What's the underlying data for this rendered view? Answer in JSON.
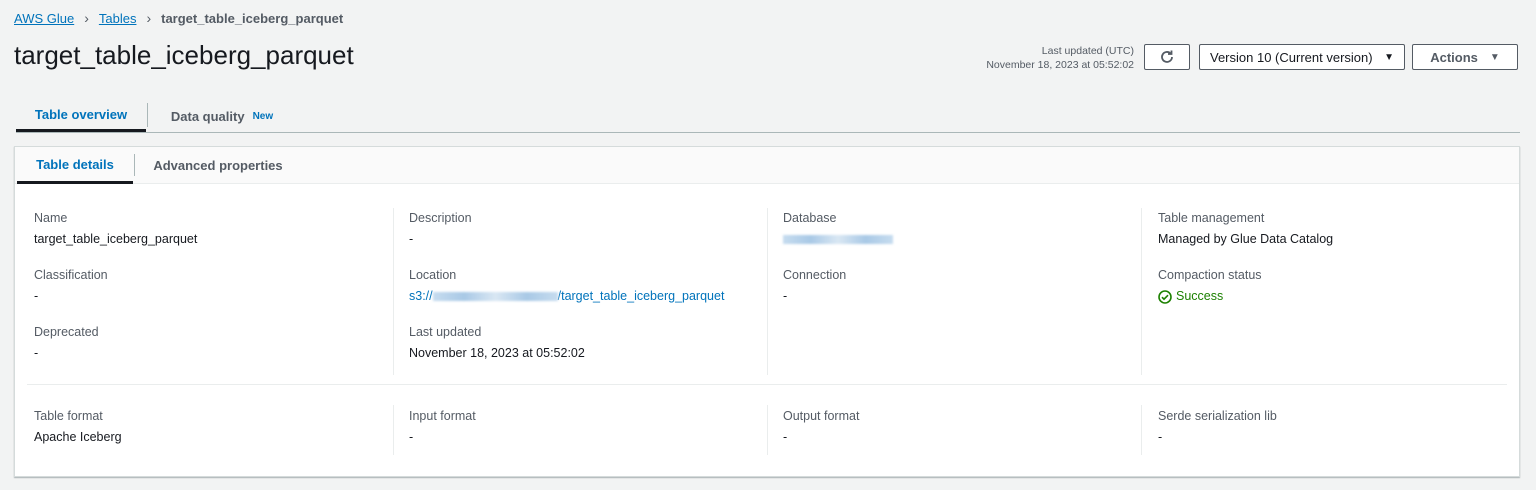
{
  "breadcrumb": [
    "AWS Glue",
    "Tables",
    "target_table_iceberg_parquet"
  ],
  "page_title": "target_table_iceberg_parquet",
  "last_updated": {
    "label": "Last updated (UTC)",
    "value": "November 18, 2023 at 05:52:02"
  },
  "version_select": "Version 10 (Current version)",
  "actions_label": "Actions",
  "tabs": [
    {
      "label": "Table overview"
    },
    {
      "label": "Data quality",
      "badge": "New"
    }
  ],
  "subtabs": [
    "Table details",
    "Advanced properties"
  ],
  "fields": {
    "name": {
      "label": "Name",
      "value": "target_table_iceberg_parquet"
    },
    "description": {
      "label": "Description",
      "value": "-"
    },
    "database": {
      "label": "Database"
    },
    "table_management": {
      "label": "Table management",
      "value": "Managed by Glue Data Catalog"
    },
    "classification": {
      "label": "Classification",
      "value": "-"
    },
    "location": {
      "label": "Location",
      "prefix": "s3://",
      "suffix": "/target_table_iceberg_parquet"
    },
    "connection": {
      "label": "Connection",
      "value": "-"
    },
    "compaction_status": {
      "label": "Compaction status",
      "value": "Success"
    },
    "deprecated": {
      "label": "Deprecated",
      "value": "-"
    },
    "last_updated": {
      "label": "Last updated",
      "value": "November 18, 2023 at 05:52:02"
    },
    "table_format": {
      "label": "Table format",
      "value": "Apache Iceberg"
    },
    "input_format": {
      "label": "Input format",
      "value": "-"
    },
    "output_format": {
      "label": "Output format",
      "value": "-"
    },
    "serde_lib": {
      "label": "Serde serialization lib",
      "value": "-"
    }
  }
}
